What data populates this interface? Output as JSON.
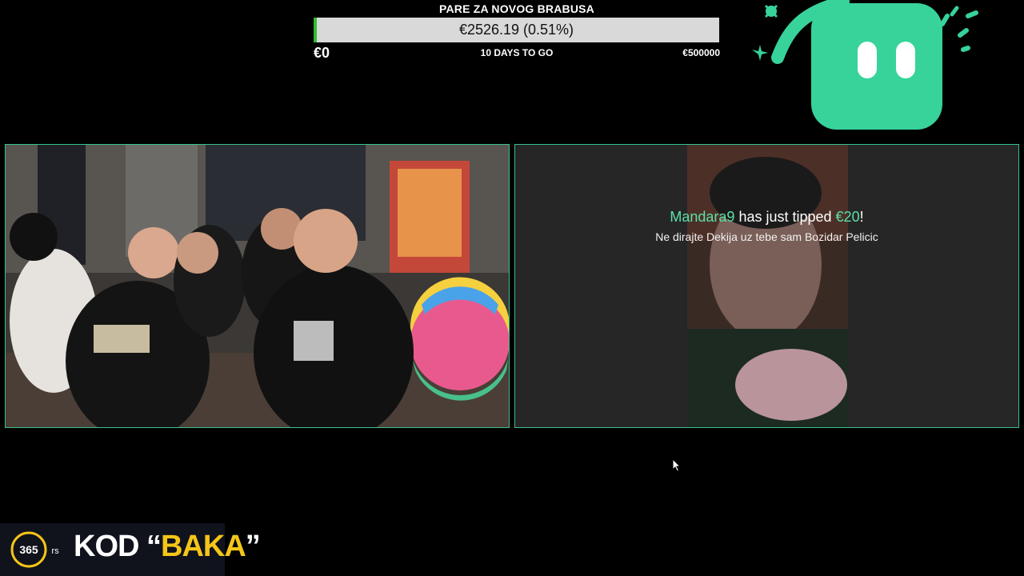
{
  "goal": {
    "title": "PARE ZA NOVOG BRABUSA",
    "amount": "€2526.19 (0.51%)",
    "progress_percent": 0.51,
    "min": "€0",
    "days_left": "10 DAYS TO GO",
    "max": "€500000",
    "bar_color": "#2fbf2f"
  },
  "logo": {
    "icon": "kick-style-chat-bubble-logo",
    "color": "#37d39a"
  },
  "cams": {
    "left": {
      "description_icon": "group-webcam-feed"
    },
    "right": {
      "description_icon": "person-webcam-feed"
    }
  },
  "tip": {
    "user": "Mandara9",
    "middle": " has just tipped ",
    "amount": "€20",
    "end": "!",
    "message": "Ne dirajte Dekija uz tebe sam Bozidar Pelicic",
    "accent_color": "#5be0a8"
  },
  "sponsor": {
    "badge": "365",
    "badge_suffix": "rs",
    "kod": "KOD ",
    "open_quote": "“",
    "code": "BAKA",
    "close_quote": "”",
    "accent_color": "#f5c518"
  }
}
